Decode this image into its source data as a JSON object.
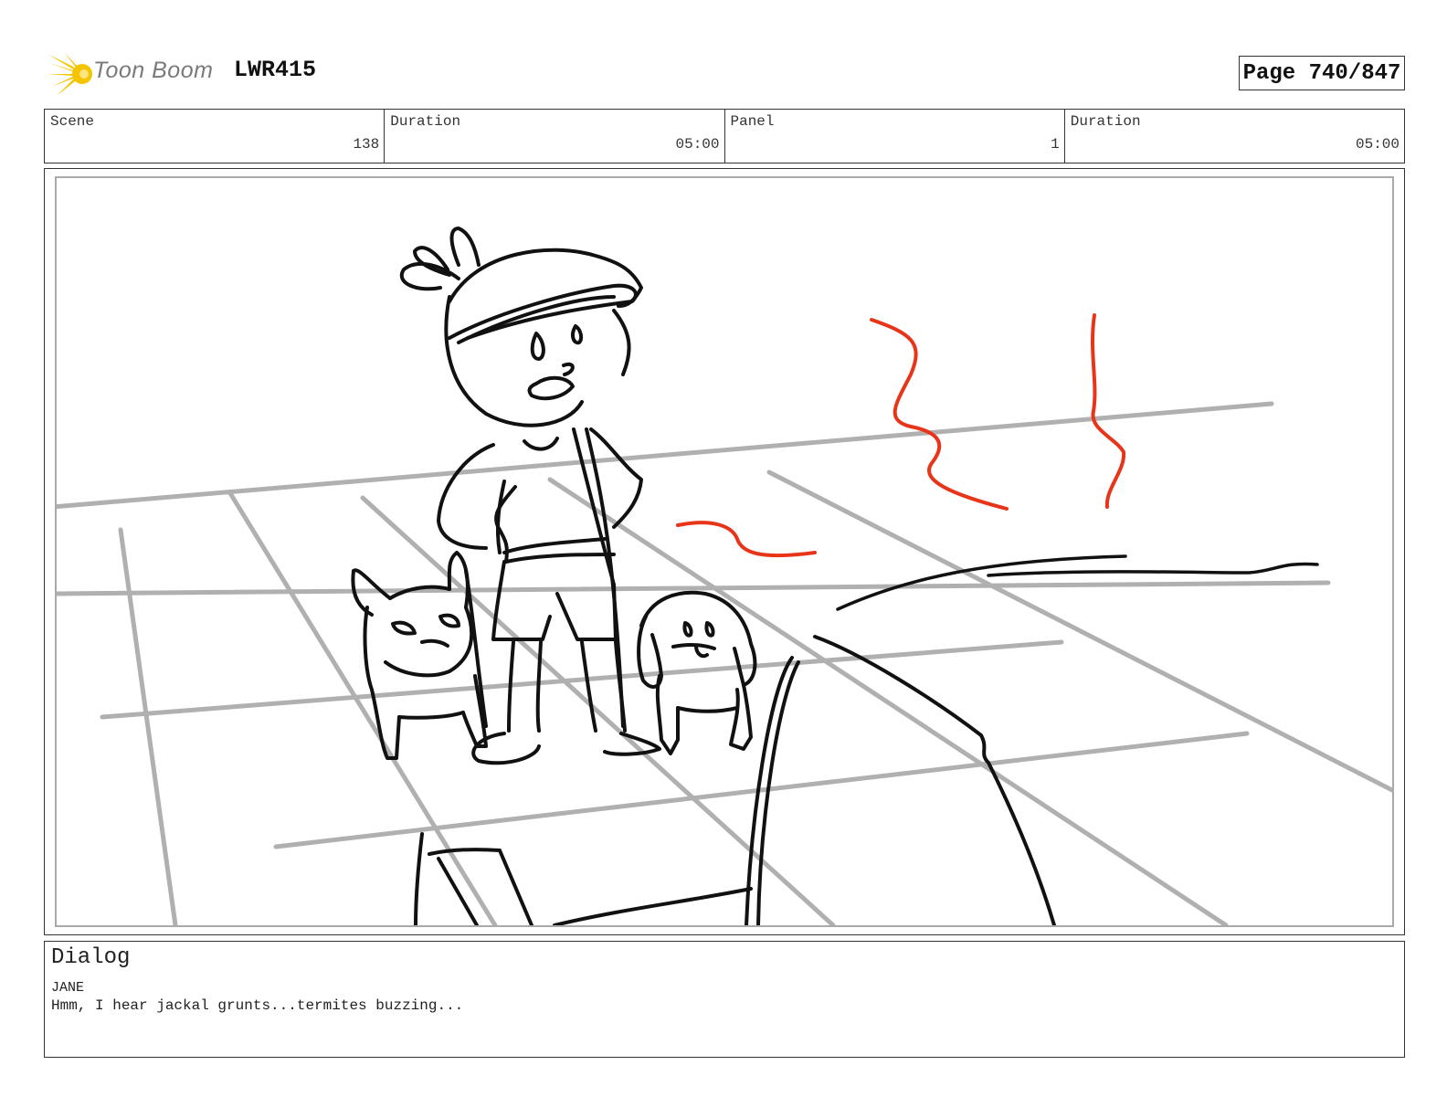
{
  "header": {
    "logo_text": "Toon Boom",
    "project": "LWR415",
    "page_label": "Page 740/847"
  },
  "info": {
    "scene_label": "Scene",
    "scene_value": "138",
    "scene_duration_label": "Duration",
    "scene_duration_value": "05:00",
    "panel_label": "Panel",
    "panel_value": "1",
    "panel_duration_label": "Duration",
    "panel_duration_value": "05:00"
  },
  "dialog": {
    "title": "Dialog",
    "speaker": "JANE",
    "line": "Hmm, I hear jackal grunts...termites buzzing..."
  },
  "colors": {
    "logo_yellow": "#f5c400",
    "grid_gray": "#b0b0b0",
    "ink": "#111111",
    "red_sound": "#e8351a"
  }
}
